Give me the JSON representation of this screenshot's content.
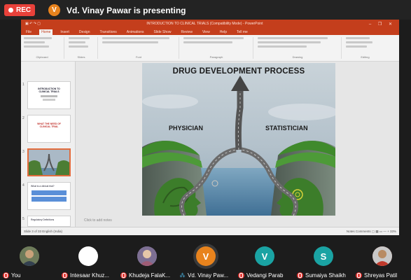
{
  "meeting": {
    "rec_label": "REC",
    "presenter_initial": "V",
    "presenter_banner": "Vd. Vinay Pawar is presenting"
  },
  "ppt": {
    "doc_title": "INTRODUCTION TO CLINICAL TRIALS (Compatibility Mode) - PowerPoint",
    "window_controls": "– ❐ ✕",
    "tabs": [
      "File",
      "Home",
      "Insert",
      "Design",
      "Transitions",
      "Animations",
      "Slide Show",
      "Review",
      "View",
      "Help",
      "Tell me"
    ],
    "active_tab": "Home",
    "groups": [
      "Clipboard",
      "Slides",
      "Font",
      "Paragraph",
      "Drawing",
      "Editing"
    ],
    "notes_hint": "Click to add notes",
    "status_left": "Slide 3 of 33   English (India)",
    "status_right": "Notes   Comments   ▢  ▦  ▭   —  +  33%",
    "thumb_numbers": [
      "1",
      "2",
      "3",
      "4",
      "5"
    ],
    "thumb1_title": "INTRODUCTION TO CLINICAL TRIALS",
    "thumb2_title": "WHAT THE NEED OF CLINICAL TRIAL",
    "thumb4_title": "What is a clinical trial?",
    "thumb5_title": "Regulatory Definitions"
  },
  "slide": {
    "title": "DRUG DEVELOPMENT PROCESS",
    "left_label": "PHYSICIAN",
    "right_label": "STATISTICIAN"
  },
  "participants": [
    {
      "name": "You",
      "avatar": "photo",
      "color": "#5b6b4a",
      "initial": ""
    },
    {
      "name": "Intesaar Khuz...",
      "avatar": "white",
      "color": "#ffffff",
      "initial": ""
    },
    {
      "name": "Khudeja FalaK...",
      "avatar": "photo",
      "color": "#8a7a9a",
      "initial": ""
    },
    {
      "name": "Vd. Vinay Paw...",
      "avatar": "letter",
      "color": "#e8831d",
      "initial": "V"
    },
    {
      "name": "Vedangi Parab",
      "avatar": "letter",
      "color": "#1aa3a3",
      "initial": "V"
    },
    {
      "name": "Sumaiya Shaikh",
      "avatar": "letter",
      "color": "#1aa3a3",
      "initial": "S"
    },
    {
      "name": "Shreyas Patil",
      "avatar": "photo",
      "color": "#b24b3e",
      "initial": ""
    }
  ]
}
